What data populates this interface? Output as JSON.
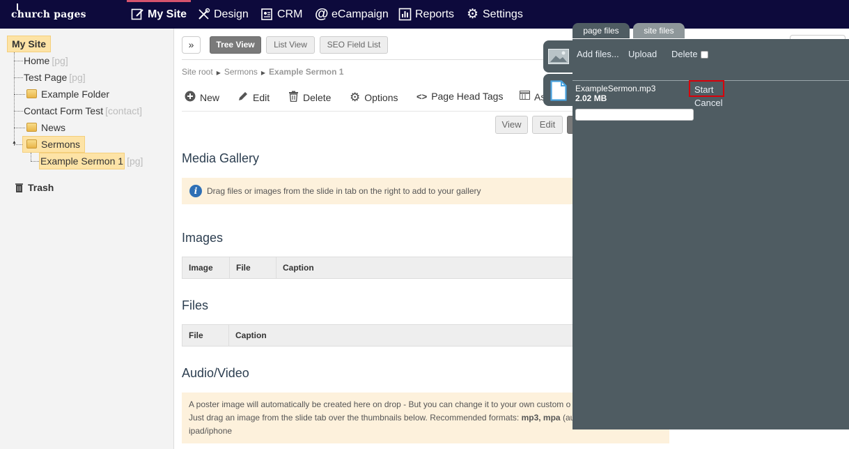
{
  "brand": {
    "logo_text": "church pages"
  },
  "nav": {
    "items": [
      {
        "label": "My Site",
        "icon": "edit-page-icon"
      },
      {
        "label": "Design",
        "icon": "tools-icon"
      },
      {
        "label": "CRM",
        "icon": "contact-card-icon"
      },
      {
        "label": "eCampaign",
        "icon": "at-sign-icon"
      },
      {
        "label": "Reports",
        "icon": "bar-chart-icon"
      },
      {
        "label": "Settings",
        "icon": "gear-icon"
      }
    ],
    "active": "My Site",
    "accent_color": "#d6536d",
    "bar_color": "#0d0a3c"
  },
  "tree": {
    "root": "My Site",
    "nodes": [
      {
        "label": "Home",
        "tag": "[pg]"
      },
      {
        "label": "Test Page",
        "tag": "[pg]"
      },
      {
        "label": "Example Folder",
        "tag": ""
      },
      {
        "label": "Contact Form Test",
        "tag": "[contact]"
      },
      {
        "label": "News",
        "tag": ""
      },
      {
        "label": "Sermons",
        "tag": ""
      },
      {
        "label": "Example Sermon 1",
        "tag": "[pg]"
      }
    ],
    "trash": "Trash",
    "highlight_color": "#fde3a6"
  },
  "view_tabs": {
    "expand": "»",
    "tree_view": "Tree View",
    "list_view": "List View",
    "seo_list": "SEO Field List"
  },
  "breadcrumb": {
    "root": "Site root",
    "parent": "Sermons",
    "current": "Example Sermon 1"
  },
  "toolbar": {
    "new": "New",
    "edit": "Edit",
    "delete": "Delete",
    "options": "Options",
    "head_tags": "Page Head Tags",
    "as": "As"
  },
  "mode_buttons": {
    "view": "View",
    "edit": "Edit"
  },
  "media_gallery": {
    "title": "Media Gallery",
    "notice": "Drag files or images from the slide in tab on the right to add to your gallery"
  },
  "images": {
    "title": "Images",
    "columns": [
      "Image",
      "File",
      "Caption"
    ]
  },
  "files": {
    "title": "Files",
    "columns": [
      "File",
      "Caption"
    ]
  },
  "audio_video": {
    "title": "Audio/Video",
    "line1": "A poster image will automatically be created here on drop - But you can change it to your own custom o",
    "line2_prefix": "Just drag an image from the slide tab over the thumbnails below. Recommended formats:",
    "formats": "mp3, mpa",
    "line2_suffix": "(au",
    "line3": "ipad/iphone"
  },
  "upload_panel": {
    "tab_page_files": "page files",
    "tab_site_files": "site files",
    "add_files": "Add files...",
    "upload": "Upload",
    "delete": "Delete",
    "file_name": "ExampleSermon.mp3",
    "file_size": "2.02 MB",
    "start": "Start",
    "cancel": "Cancel",
    "panel_color": "#4f5c62"
  }
}
